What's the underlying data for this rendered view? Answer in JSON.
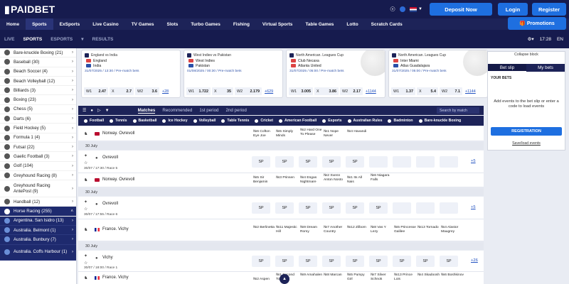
{
  "header": {
    "logo": "PAIDBET",
    "deposit_label": "Deposit Now",
    "login_label": "Login",
    "register_label": "Register",
    "headset_icon": "headset-icon",
    "language_flag": "uk-flag-icon"
  },
  "nav": {
    "items": [
      "Home",
      "Sports",
      "ExSports",
      "Live Casino",
      "TV Games",
      "Slots",
      "Turbo Games",
      "Fishing",
      "Virtual Sports",
      "Table Games",
      "Lotto",
      "Scratch Cards"
    ],
    "promotions_label": "Promotions"
  },
  "subnav": {
    "items": [
      "LIVE",
      "SPORTS",
      "ESPORTS",
      "RESULTS"
    ],
    "time": "17:28",
    "lang": "EN"
  },
  "sidebar": {
    "items": [
      {
        "label": "Bare-knuckle Boxing (21)"
      },
      {
        "label": "Baseball (30)"
      },
      {
        "label": "Beach Soccer (4)"
      },
      {
        "label": "Beach Volleyball (12)"
      },
      {
        "label": "Billiards (3)"
      },
      {
        "label": "Boxing (23)"
      },
      {
        "label": "Chess (5)"
      },
      {
        "label": "Darts (6)"
      },
      {
        "label": "Field Hockey (5)"
      },
      {
        "label": "Formula 1 (4)"
      },
      {
        "label": "Futsal (22)"
      },
      {
        "label": "Gaelic Football (3)"
      },
      {
        "label": "Golf (104)"
      },
      {
        "label": "Greyhound Racing (8)"
      },
      {
        "label": "Greyhound Racing AntePost (9)"
      },
      {
        "label": "Handball (12)"
      },
      {
        "label": "Horse Racing (255)"
      },
      {
        "label": "Argentina. San Isidro (13)"
      },
      {
        "label": "Australia. Belmont (1)"
      },
      {
        "label": "Australia. Bunbury (7)"
      },
      {
        "label": "Australia. Coffs Harbour (1)"
      }
    ]
  },
  "cards": [
    {
      "league": "England vs India",
      "team1": "England",
      "team2": "India",
      "date": "31/07/2025 / 13:30 / Pre-match bets",
      "o1": "2.47",
      "ox": "2.7",
      "o2": "3.6",
      "more": "+28"
    },
    {
      "league": "West Indies vs Pakistan",
      "team1": "West Indies",
      "team2": "Pakistan",
      "date": "01/08/2025 / 00:30 / Pre-match bets",
      "o1": "1.722",
      "ox": "35",
      "o2": "2.179",
      "more": "+629"
    },
    {
      "league": "North American. Leagues Cup",
      "team1": "Club Necaxa",
      "team2": "Atlanta United",
      "date": "31/07/2025 / 05:00 / Pre-match bets",
      "o1": "3.005",
      "ox": "3.86",
      "o2": "2.17",
      "more": "+1144"
    },
    {
      "league": "North American. Leagues Cup",
      "team1": "Inter Miami",
      "team2": "Atlas Guadalajara",
      "date": "31/07/2025 / 05:00 / Pre-match bets",
      "o1": "1.37",
      "ox": "5.4",
      "o2": "7.1",
      "more": "+1144"
    }
  ],
  "filters": {
    "tabs": [
      "Matches",
      "Recommended",
      "1st period",
      "2nd period"
    ],
    "search_placeholder": "Search by match"
  },
  "sports_bar": [
    "Football",
    "Tennis",
    "Basketball",
    "Ice Hockey",
    "Volleyball",
    "Table Tennis",
    "Cricket",
    "American Football",
    "Esports",
    "Australian Rules",
    "Badminton",
    "Bare-knuckle Boxing"
  ],
  "events": {
    "r1": {
      "name": "Norway. Ovrevoll",
      "runners": [
        "№6 Cofton Eye Joe",
        "№5 Simply Minds",
        "№2 Hard One To Please",
        "№1 Nope Never",
        "№4 Havandi"
      ]
    },
    "d1": "30 July",
    "r2": {
      "name": "Ovrevoll",
      "sub": "30/07 / 17:30 / Race 5",
      "more": "+5"
    },
    "r3": {
      "name": "Norway. Ovrevoll",
      "runners": [
        "№5 Sir Benjamin",
        "№3 Prinsen",
        "№4 Engas Nightmare",
        "№2 Svenn Anton Nosto",
        "№1 Its All Nais",
        "№6 Niagara Falls"
      ]
    },
    "d2": "30 July",
    "r4": {
      "name": "Ovrevoll",
      "sub": "30/07 / 17:55 / Race 6",
      "more": "+5"
    },
    "r5": {
      "name": "France. Vichy",
      "runners": [
        "№2 Berlinetta",
        "№11 Majestic Hill",
        "№9 Dream Romy",
        "№7 Another Country",
        "№12 Zilborn",
        "№8 Vas Y Lezy",
        "№5 Princesse Galilee",
        "№13 Tornado",
        "№4 Alastor Maugrey"
      ]
    },
    "d3": "30 July",
    "r6": {
      "name": "Vichy",
      "sub": "30/07 / 18:00 / Race 1",
      "more": "+26"
    },
    "r7": {
      "name": "France. Vichy",
      "runners": [
        "№2 Aspen",
        "№1 Second To None",
        "№9 Amahalen",
        "№8 Marcan",
        "№5 Pumpy Girl",
        "№7 Silver Schnok",
        "№13 Prince Lois",
        "№4 Skadoosh",
        "№6 Boshkinov"
      ]
    },
    "sp_label": "SP"
  },
  "betslip": {
    "collapse": "Collapse block",
    "tab1": "Bet slip",
    "tab2": "My bets",
    "your_bets": "YOUR BETS",
    "add_events": "Add events to the bet slip or enter a code to load events",
    "registration": "REGISTRATION",
    "save_load": "Save/load events"
  },
  "colors": {
    "navy": "#161b4e",
    "accent": "#1e6fe0"
  }
}
